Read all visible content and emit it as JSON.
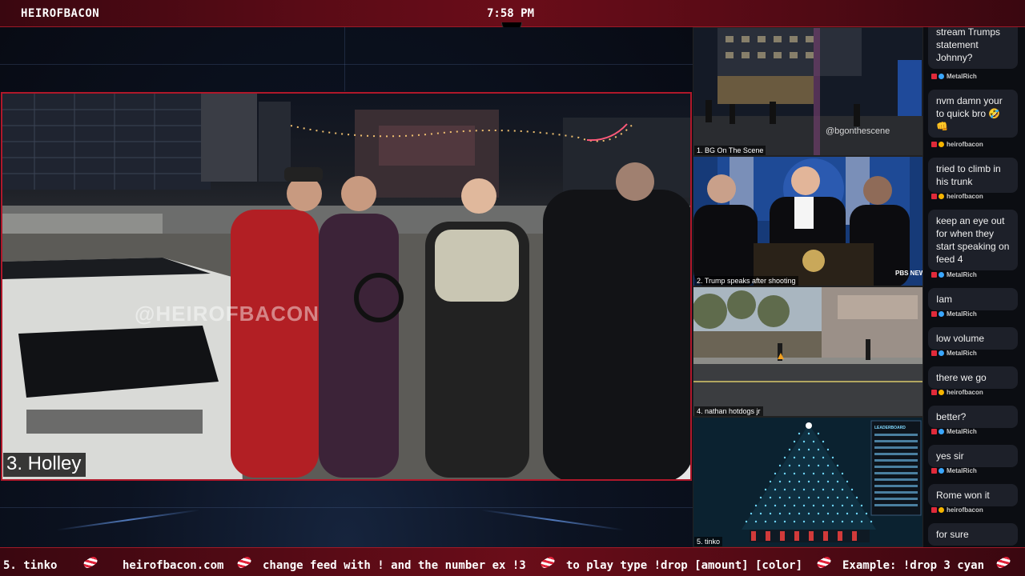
{
  "topbar": {
    "channel": "HEIROFBACON",
    "time": "7:58 PM"
  },
  "main_feed": {
    "label": "3. Holley",
    "watermark": "@HEIROFBACON"
  },
  "side_feeds": [
    {
      "label": "1. BG On The Scene",
      "overlay": "@bgonthescene"
    },
    {
      "label": "2. Trump speaks after shooting",
      "overlay": "PBS NEWS"
    },
    {
      "label": "4. nathan hotdogs jr"
    },
    {
      "label": "5. tinko",
      "overlay": "LEADERBOARD"
    }
  ],
  "chat": {
    "messages": [
      {
        "type": "text",
        "text": "stream Trumps statement Johnny?"
      },
      {
        "type": "user",
        "user": "MetalRich",
        "badge_color": "#3aa7ff"
      },
      {
        "type": "text",
        "text": "nvm damn your to quick bro 🤣 👊"
      },
      {
        "type": "user",
        "user": "heirofbacon",
        "badge_color": "#f5b400"
      },
      {
        "type": "text",
        "text": "tried to climb in his trunk"
      },
      {
        "type": "user",
        "user": "heirofbacon",
        "badge_color": "#f5b400"
      },
      {
        "type": "text",
        "text": "keep an eye out for when they start speaking on feed 4"
      },
      {
        "type": "user",
        "user": "MetalRich",
        "badge_color": "#3aa7ff"
      },
      {
        "type": "text",
        "text": "Iam"
      },
      {
        "type": "user",
        "user": "MetalRich",
        "badge_color": "#3aa7ff"
      },
      {
        "type": "text",
        "text": "low volume"
      },
      {
        "type": "user",
        "user": "MetalRich",
        "badge_color": "#3aa7ff"
      },
      {
        "type": "text",
        "text": "there we go"
      },
      {
        "type": "user",
        "user": "heirofbacon",
        "badge_color": "#f5b400"
      },
      {
        "type": "text",
        "text": "better?"
      },
      {
        "type": "user",
        "user": "MetalRich",
        "badge_color": "#3aa7ff"
      },
      {
        "type": "text",
        "text": "yes sir"
      },
      {
        "type": "user",
        "user": "MetalRich",
        "badge_color": "#3aa7ff"
      },
      {
        "type": "text",
        "text": "Rome won it"
      },
      {
        "type": "user",
        "user": "heirofbacon",
        "badge_color": "#f5b400"
      },
      {
        "type": "text",
        "text": "for sure"
      }
    ]
  },
  "ticker": {
    "items": [
      "5. tinko",
      "heirofbacon.com",
      "change feed with ! and the number ex !3",
      "to play type !drop [amount] [color]",
      "Example: !drop 3 cyan"
    ],
    "separator_icon": "candy-cane-icon"
  },
  "colors": {
    "accent": "#b0182a",
    "topbar": "#5a0b16",
    "chat_bg": "#0b0d12",
    "bubble": "#1d2029"
  }
}
